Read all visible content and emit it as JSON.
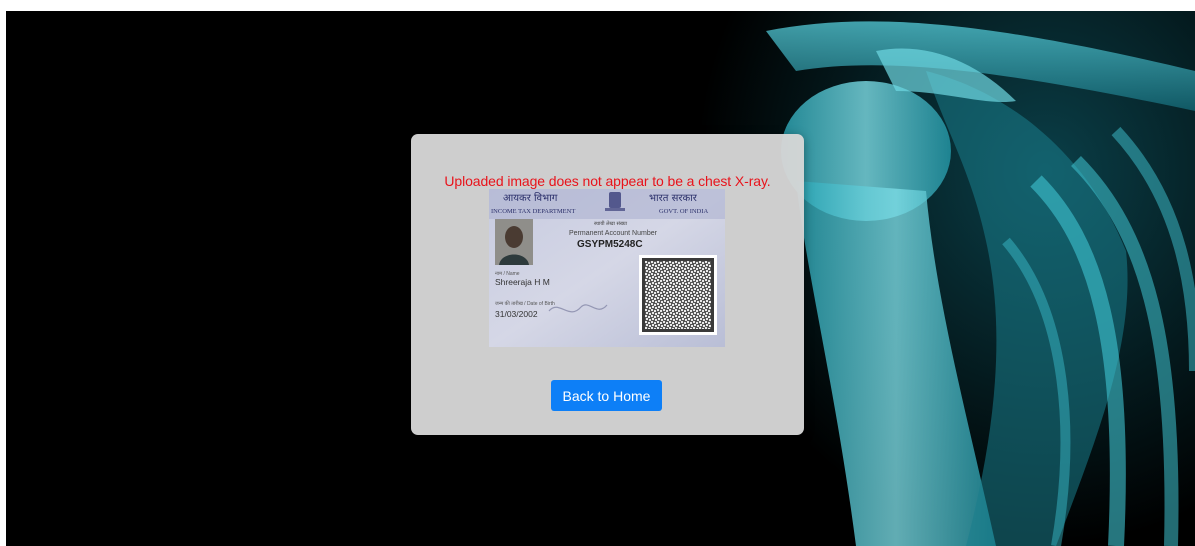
{
  "message": {
    "text": "Uploaded image does not appear to be a chest X-ray.",
    "color": "#e8131b"
  },
  "uploaded_image": {
    "hindi_left": "आयकर विभाग",
    "dept_left": "INCOME TAX DEPARTMENT",
    "hindi_right": "भारत सरकार",
    "dept_right": "GOVT. OF INDIA",
    "hindi_pan": "स्थायी लेखा संख्या",
    "pan_label": "Permanent Account Number",
    "pan_number": "GSYPM5248C",
    "name_label": "नाम / Name",
    "name_value": "Shreeraja H M",
    "dob_label": "जन्म की तारीख / Date of Birth",
    "dob_value": "31/03/2002",
    "emblem_icon": "national-emblem-icon",
    "qr_icon": "qr-code-icon"
  },
  "actions": {
    "back_label": "Back to Home",
    "back_color": "#0d7ff7"
  },
  "background": {
    "base_color": "#000000",
    "xray_color": "#3fc4d2"
  }
}
